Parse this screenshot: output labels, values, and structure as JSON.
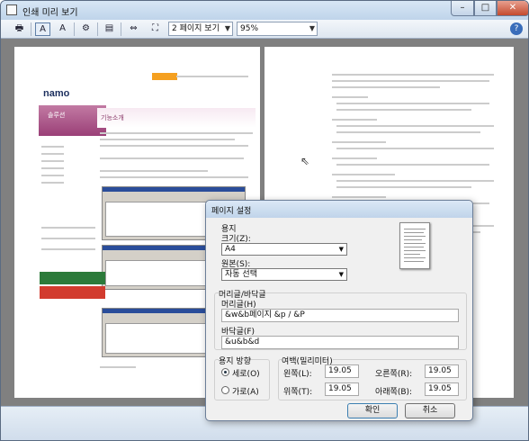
{
  "window": {
    "title": "인쇄 미리 보기"
  },
  "toolbar": {
    "pages_combo": "2 페이지 보기",
    "zoom_combo": "95%"
  },
  "dialog": {
    "title": "페이지 설정",
    "paper": {
      "group_label": "용지",
      "size_label": "크기(Z):",
      "size_value": "A4",
      "source_label": "원본(S):",
      "source_value": "자동 선택"
    },
    "header_footer": {
      "group_label": "머리글/바닥글",
      "header_label": "머리글(H)",
      "header_value": "&w&b페이지 &p / &P",
      "footer_label": "바닥글(F)",
      "footer_value": "&u&b&d"
    },
    "orientation": {
      "group_label": "용지 방향",
      "portrait": "세로(O)",
      "landscape": "가로(A)",
      "selected": "portrait"
    },
    "margins": {
      "group_label": "여백(밀리미터)",
      "left_label": "왼쪽(L):",
      "left_value": "19.05",
      "right_label": "오른쪽(R):",
      "right_value": "19.05",
      "top_label": "위쪽(T):",
      "top_value": "19.05",
      "bottom_label": "아래쪽(B):",
      "bottom_value": "19.05"
    },
    "ok_label": "확인",
    "cancel_label": "취소"
  },
  "preview": {
    "left_page": {
      "logo": "namo",
      "menu_title": "솔루션",
      "heading": "기능소개"
    }
  }
}
